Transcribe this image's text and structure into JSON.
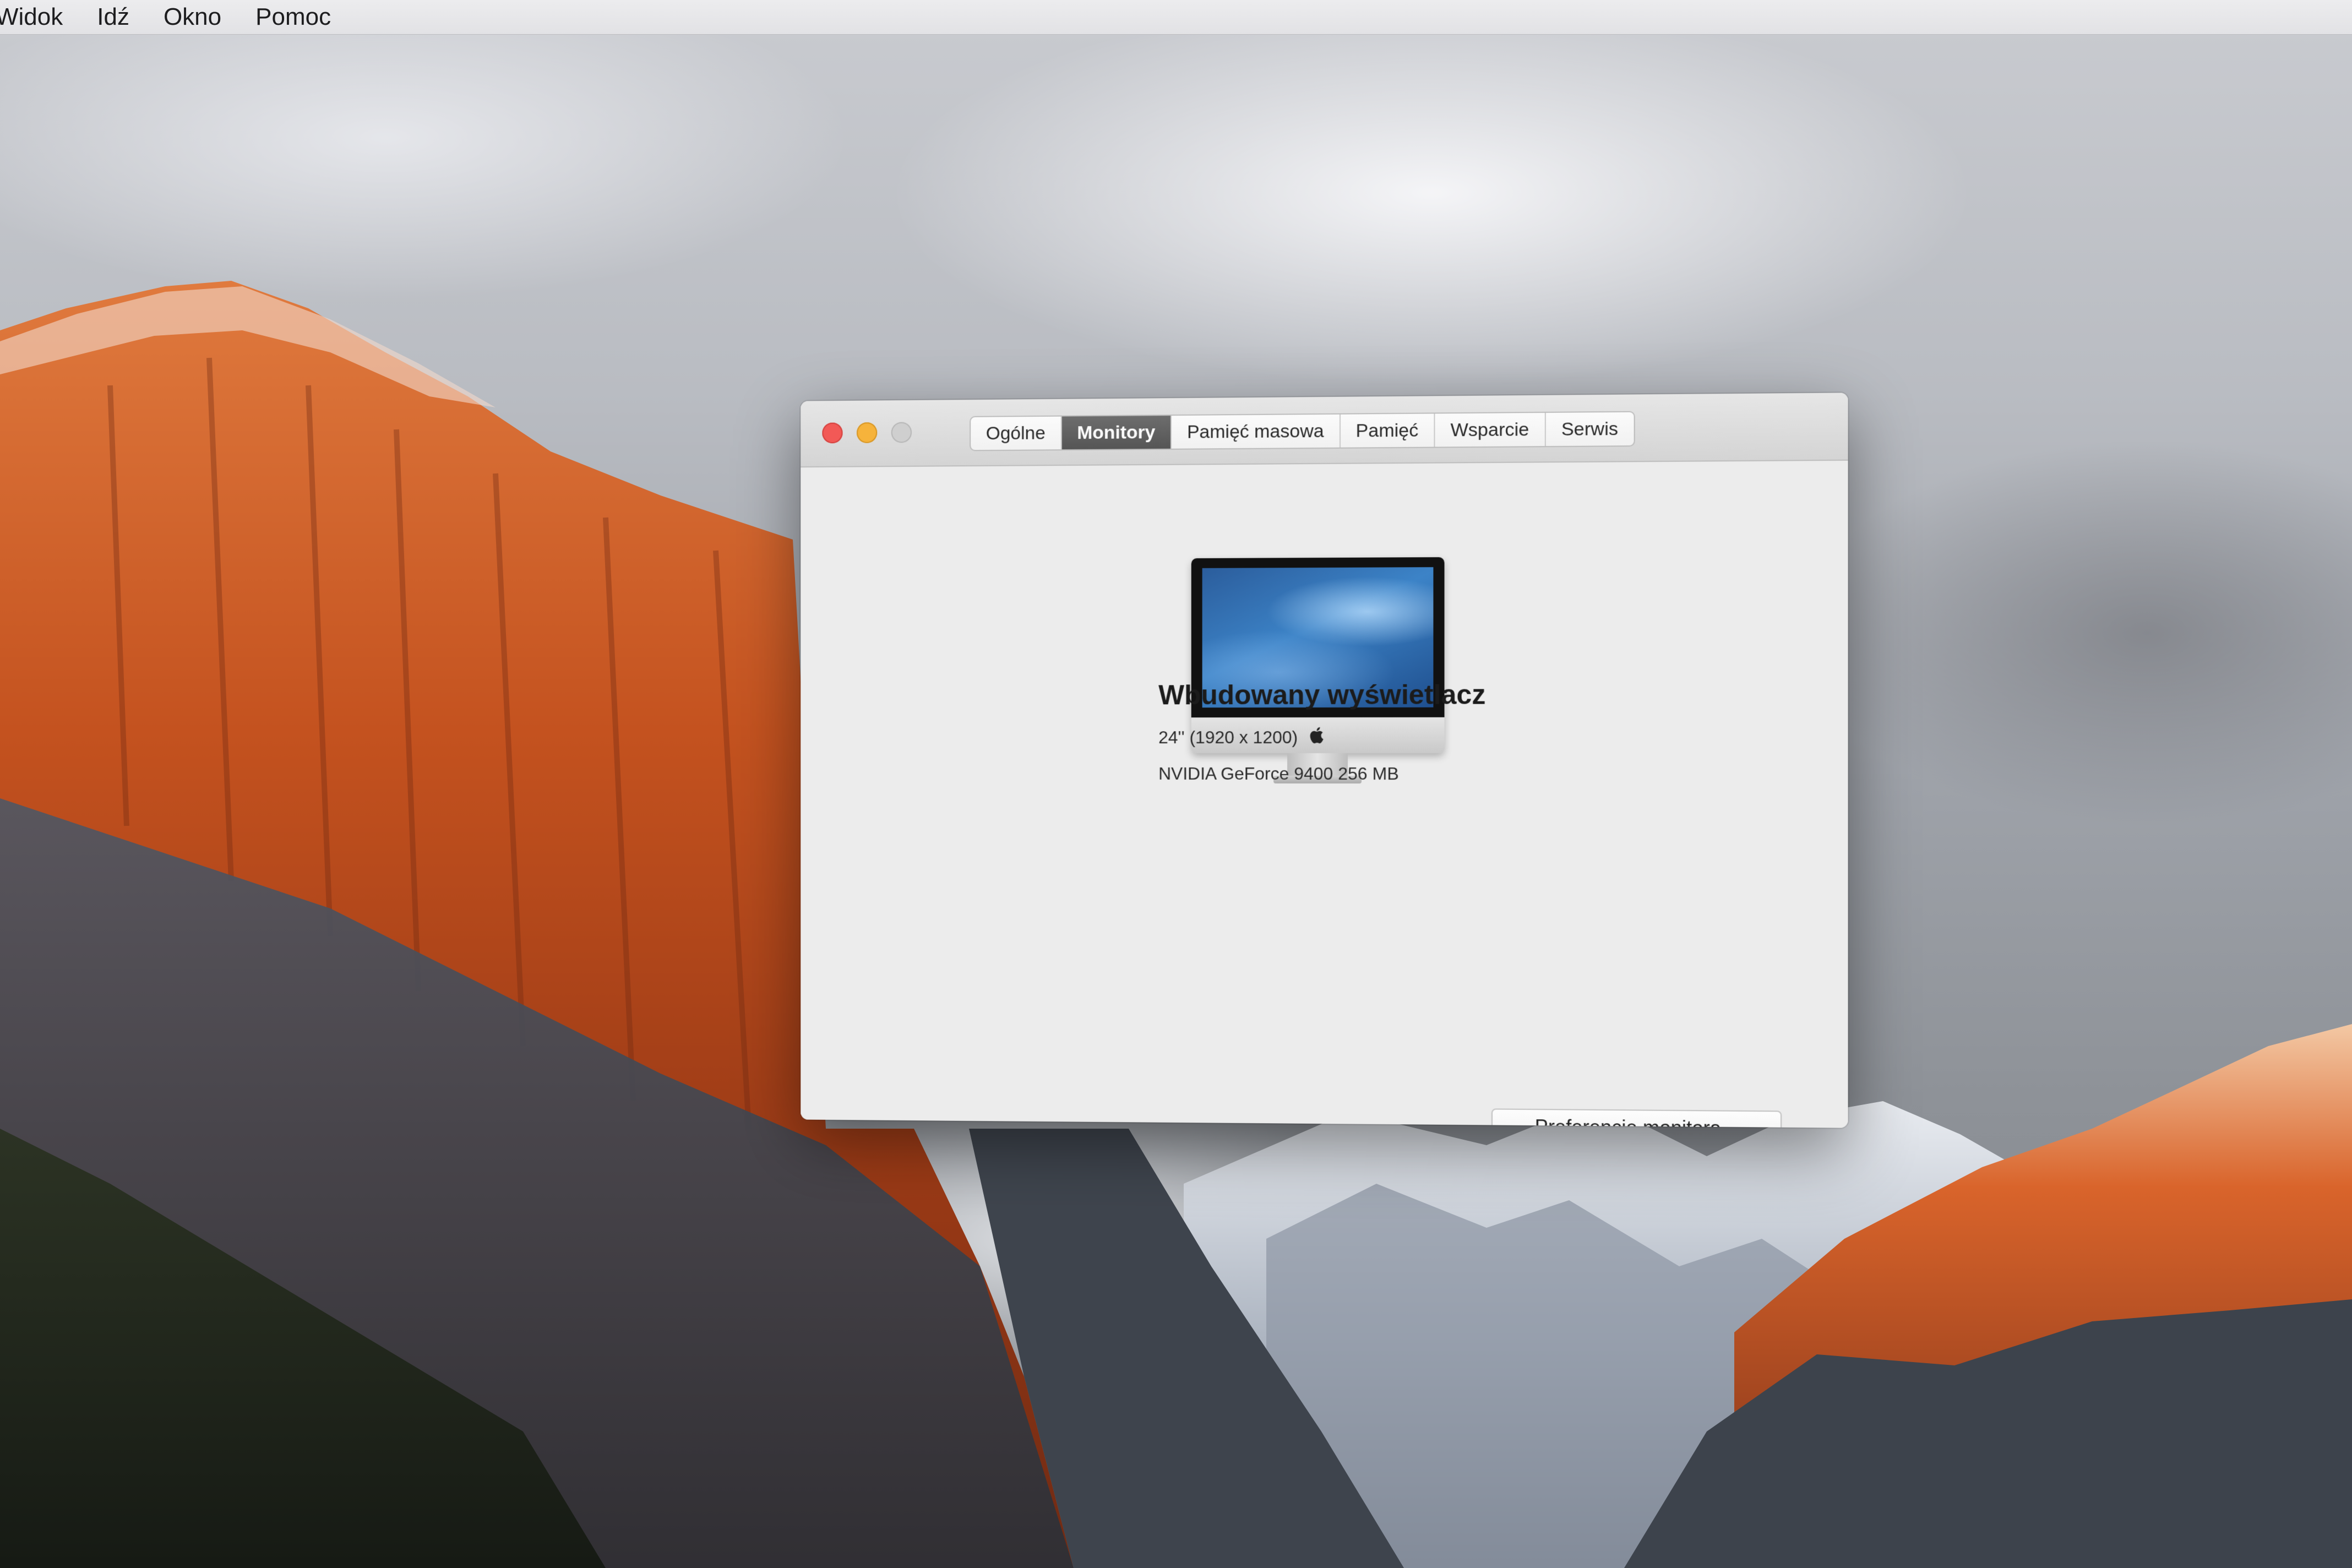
{
  "menubar": {
    "items": [
      "Widok",
      "Idź",
      "Okno",
      "Pomoc"
    ]
  },
  "window": {
    "tabs": [
      "Ogólne",
      "Monitory",
      "Pamięć masowa",
      "Pamięć",
      "Wsparcie",
      "Serwis"
    ],
    "active_tab": "Monitory",
    "display": {
      "name": "Wbudowany wyświetlacz",
      "size": "24'' (1920 x 1200)",
      "gpu": "NVIDIA GeForce 9400 256  MB"
    },
    "preferences_button": "Preferencje monitora..."
  },
  "colors": {
    "close": "#f25956",
    "minimize": "#f6b33b",
    "zoom": "#cfcfcf",
    "active_tab": "#5f5f5f"
  },
  "icons": {
    "display": "imac-icon",
    "logo": "apple-logo-icon"
  }
}
